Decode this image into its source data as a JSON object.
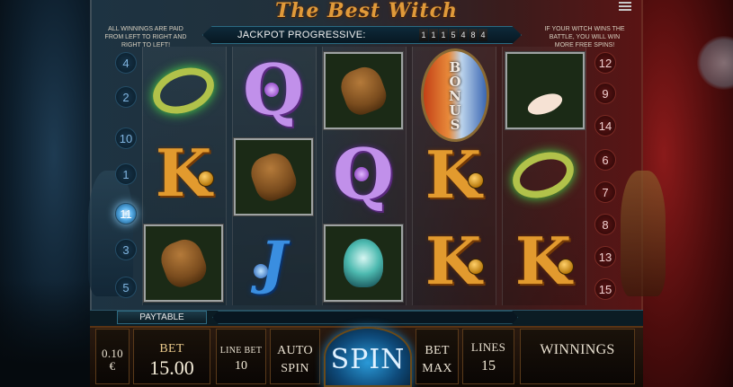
{
  "title": "The Best Witch",
  "info_left": "All winnings are paid from left to right and right to left!",
  "info_right": "If your witch wins the battle, you will win more free spins!",
  "jackpot": {
    "label": "JACKPOT PROGRESSIVE:",
    "digits": [
      "1",
      "1",
      "1",
      "5",
      "4",
      "8",
      "4"
    ]
  },
  "lines_left": [
    "4",
    "2",
    "10",
    "1",
    "11",
    "3",
    "5"
  ],
  "lines_right": [
    "12",
    "9",
    "14",
    "6",
    "7",
    "8",
    "13",
    "15"
  ],
  "reels": [
    [
      "ring",
      "K",
      "voodoo-doll"
    ],
    [
      "Q",
      "voodoo-doll",
      "J"
    ],
    [
      "voodoo-doll",
      "Q",
      "crystal-skull"
    ],
    [
      "bonus",
      "K",
      "K"
    ],
    [
      "fire-hand",
      "ring",
      "K"
    ]
  ],
  "bonus_text": "BONUS",
  "paytable_label": "PAYTABLE",
  "controls": {
    "coin_value": "0.10\n€",
    "bet_label": "BET",
    "bet_value": "15.00",
    "line_bet_label": "LINE BET",
    "line_bet_value": "10",
    "auto_spin_label": "AUTO SPIN",
    "spin_label": "SPIN",
    "bet_max_label": "BET MAX",
    "lines_label": "LINES",
    "lines_value": "15",
    "winnings_label": "WINNINGS"
  },
  "colors": {
    "title": "#e09a3a",
    "k_symbol": "#e29a2e",
    "q_symbol": "#c190ea",
    "j_symbol": "#3a8ee0",
    "spin_glow": "#2a9ad8"
  }
}
